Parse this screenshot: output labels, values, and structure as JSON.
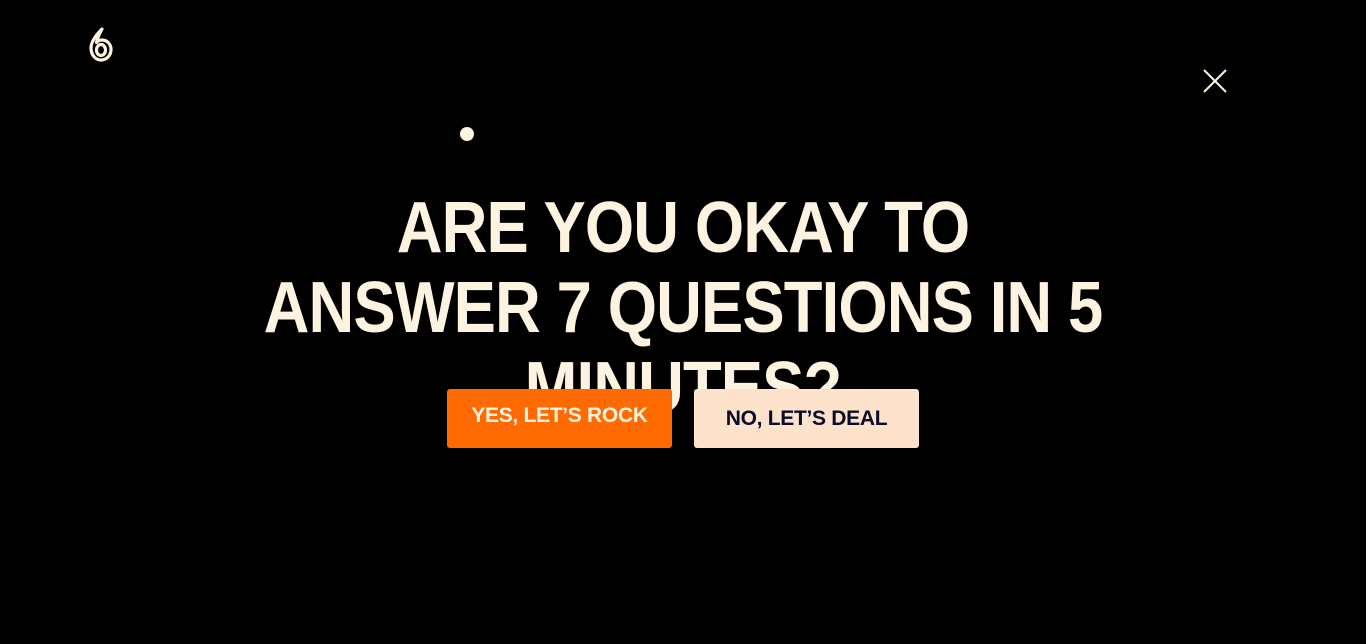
{
  "brand": {
    "logo_icon": "flame-logo-icon"
  },
  "dialog": {
    "close_icon": "close-icon",
    "progress_indicator": "progress-dot",
    "question": "ARE YOU OKAY TO ANSWER 7 QUESTIONS IN 5 MINUTES?",
    "yes_label": "YES, LET’S ROCK",
    "no_label": "NO, LET’S DEAL"
  },
  "colors": {
    "background": "#000000",
    "text": "#fdf3e0",
    "accent": "#ff6b00",
    "secondary_button": "#fde3cc",
    "secondary_text": "#0b0b2a"
  }
}
